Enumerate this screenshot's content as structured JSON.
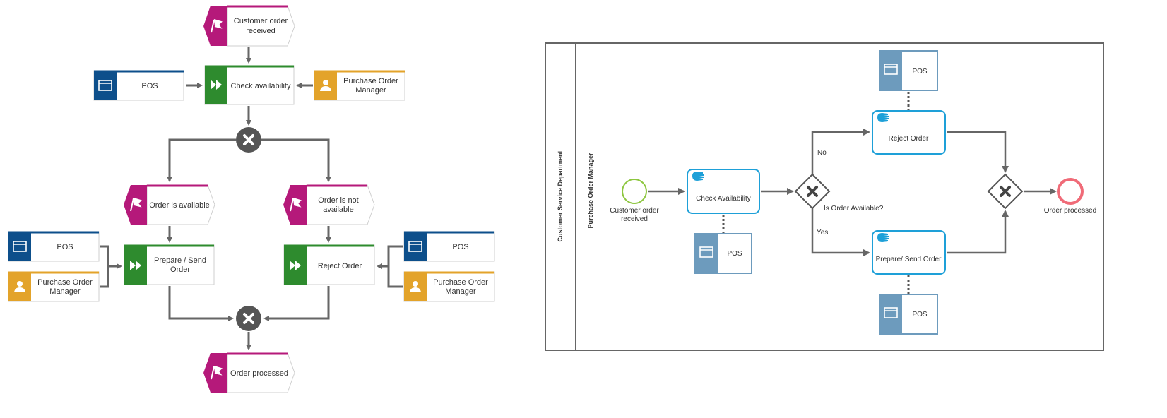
{
  "colors": {
    "event": "#b5197a",
    "function": "#2e8b2e",
    "system": "#0d4f8b",
    "role": "#e3a32a",
    "bpmn_task": "#1ea0d8",
    "bpmn_data": "#6d9bbd",
    "start": "#8dc63f",
    "end": "#f06b78",
    "connector": "#666666"
  },
  "epc": {
    "start_event": [
      "Customer order",
      "received"
    ],
    "check_function": "Check availability",
    "pos_top": "POS",
    "manager_top": [
      "Purchase Order",
      "Manager"
    ],
    "event_available": "Order is available",
    "event_not_available": [
      "Order is not",
      "available"
    ],
    "prepare_function": [
      "Prepare / Send",
      "Order"
    ],
    "reject_function": "Reject Order",
    "pos_left": "POS",
    "manager_left": [
      "Purchase Order",
      "Manager"
    ],
    "pos_right": "POS",
    "manager_right": [
      "Purchase Order",
      "Manager"
    ],
    "end_event": "Order processed"
  },
  "bpmn": {
    "pool": "Customer Service Department",
    "lane": "Purchase Order Manager",
    "start_event": [
      "Customer order",
      "received"
    ],
    "check_task": "Check Availability",
    "pos_check": "POS",
    "gateway_label": "Is Order Available?",
    "no_label": "No",
    "yes_label": "Yes",
    "reject_task": "Reject Order",
    "pos_reject": "POS",
    "prepare_task": "Prepare/ Send Order",
    "pos_prepare": "POS",
    "end_event": "Order processed"
  }
}
